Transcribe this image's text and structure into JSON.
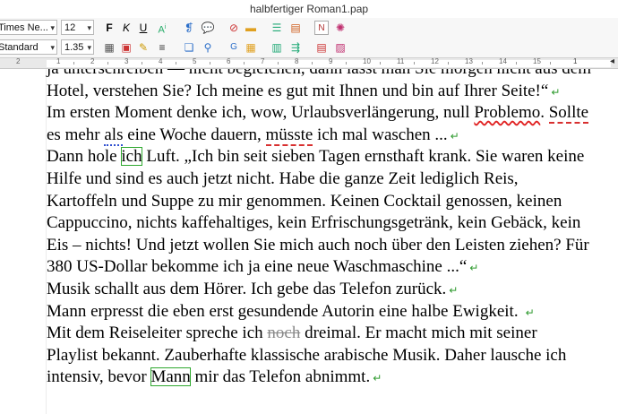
{
  "window": {
    "title": "halbfertiger Roman1.pap"
  },
  "toolbar": {
    "font_name": "Times Ne...",
    "font_size": "12",
    "style_name": "Standard",
    "line_spacing": "1.35"
  },
  "ruler": {
    "labels": [
      "2",
      "1",
      "1",
      "2",
      "3",
      "4",
      "5",
      "6",
      "7",
      "8",
      "9",
      "10",
      "11",
      "12",
      "13",
      "14",
      "15"
    ]
  },
  "document": {
    "line1": "ja unterschreiben — nicht begleichen, dann lässt man Sie morgen nicht aus dem",
    "line2": "Hotel, verstehen Sie? Ich meine es gut mit Ihnen und bin auf Ihrer Seite!“",
    "line3a": "Im ersten Moment denke ich, wow, Urlaubsverlängerung, null ",
    "line3b": "Problemo",
    "line3c": ". ",
    "line3d": "Sollte",
    "line4a": "es mehr ",
    "line4b": "als",
    "line4c": " eine Woche dauern, ",
    "line4d": "müsste",
    "line4e": " ich mal waschen ...",
    "line5a": "Dann hole ",
    "line5b": "ich",
    "line5c": " Luft. „Ich bin seit sieben Tagen ernsthaft krank. Sie waren keine",
    "line6": "Hilfe und sind es auch jetzt nicht. Habe die ganze Zeit lediglich Reis,",
    "line7": "Kartoffeln und Suppe zu mir genommen. Keinen Cocktail genossen, keinen",
    "line8": "Cappuccino, nichts kaffehaltiges, kein Erfrischungsgetränk, kein Gebäck, kein",
    "line9": "Eis – nichts! Und jetzt wollen Sie mich auch noch über den Leisten ziehen? Für",
    "line10": "380 US-Dollar bekomme ich ja eine neue Waschmaschine ...“",
    "line11": "Musik schallt aus dem Hörer. Ich gebe das Telefon zurück.",
    "line12": "Mann erpresst die eben erst gesundende Autorin eine halbe Ewigkeit.",
    "line13a": "Mit dem Reiseleiter spreche ich ",
    "line13b": "noch",
    "line13c": " dreimal. Er macht mich mit seiner",
    "line14": "Playlist bekannt. Zauberhafte klassische arabische Musik. Daher lausche ich",
    "line15a": "intensiv, bevor ",
    "line15b": "Mann",
    "line15c": " mir das Telefon abnimmt."
  },
  "icons": {
    "paragraph_mark": "↵"
  }
}
